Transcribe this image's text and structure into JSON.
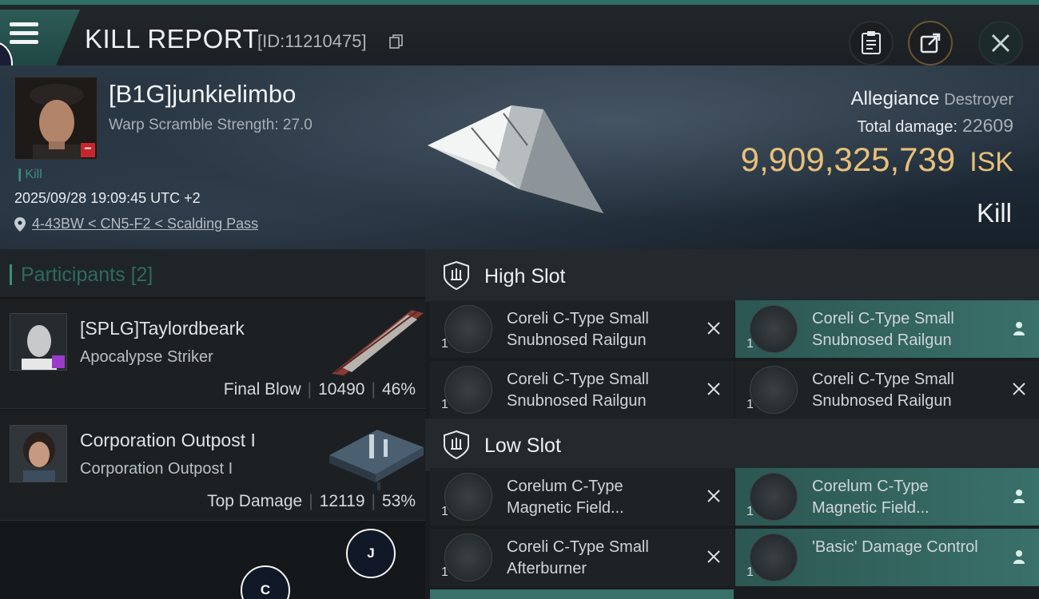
{
  "header": {
    "title": "KILL REPORT",
    "kill_id": "[ID:11210475]"
  },
  "victim": {
    "name": "[B1G]junkielimbo",
    "warp_scramble": "Warp Scramble Strength: 27.0",
    "kill_tag": "Kill",
    "datetime": "2025/09/28 19:09:45 UTC +2",
    "location": "4-43BW < CN5-F2 < Scalding Pass",
    "ship_name": "Allegiance",
    "ship_class": "Destroyer",
    "total_damage_label": "Total damage:",
    "total_damage": "22609",
    "isk_value": "9,909,325,739",
    "isk_unit": "ISK",
    "result": "Kill"
  },
  "participants": {
    "label": "Participants",
    "count": "[2]",
    "items": [
      {
        "name": "[SPLG]Taylordbeark",
        "ship": "Apocalypse Striker",
        "role": "Final Blow",
        "damage": "10490",
        "percent": "46%"
      },
      {
        "name": "Corporation Outpost I",
        "ship": "Corporation Outpost I",
        "role": "Top Damage",
        "damage": "12119",
        "percent": "53%"
      }
    ]
  },
  "slots": {
    "high": {
      "label": "High Slot",
      "modules": [
        {
          "name": "Coreli C-Type Small Snubnosed Railgun",
          "qty": "1",
          "status": "destroyed"
        },
        {
          "name": "Coreli C-Type Small Snubnosed Railgun",
          "qty": "1",
          "status": "dropped"
        },
        {
          "name": "Coreli C-Type Small Snubnosed Railgun",
          "qty": "1",
          "status": "destroyed"
        },
        {
          "name": "Coreli C-Type Small Snubnosed Railgun",
          "qty": "1",
          "status": "destroyed"
        }
      ]
    },
    "low": {
      "label": "Low Slot",
      "modules": [
        {
          "name": "Corelum C-Type Magnetic Field...",
          "qty": "1",
          "status": "destroyed"
        },
        {
          "name": "Corelum C-Type Magnetic Field...",
          "qty": "1",
          "status": "dropped"
        },
        {
          "name": "Coreli C-Type Small Afterburner",
          "qty": "1",
          "status": "destroyed"
        },
        {
          "name": "'Basic' Damage Control",
          "qty": "1",
          "status": "dropped"
        }
      ]
    }
  },
  "overlay": {
    "fab_j": "J",
    "fab_c": "C"
  },
  "colors": {
    "accent": "#3a8d7d",
    "isk": "#e7c07a",
    "dropped_highlight": "#3a706a"
  }
}
